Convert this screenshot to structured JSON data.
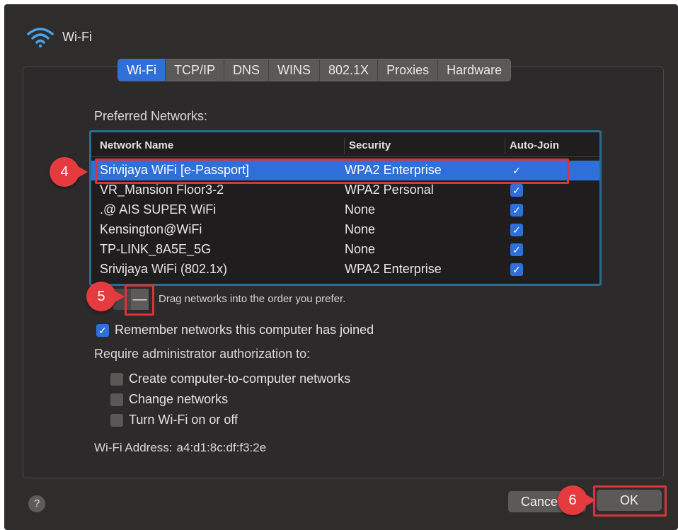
{
  "header": {
    "title": "Wi-Fi",
    "icon": "wifi-icon"
  },
  "tabs": [
    {
      "label": "Wi-Fi",
      "active": true
    },
    {
      "label": "TCP/IP",
      "active": false
    },
    {
      "label": "DNS",
      "active": false
    },
    {
      "label": "WINS",
      "active": false
    },
    {
      "label": "802.1X",
      "active": false
    },
    {
      "label": "Proxies",
      "active": false
    },
    {
      "label": "Hardware",
      "active": false
    }
  ],
  "preferred_label": "Preferred Networks:",
  "table": {
    "headers": {
      "name": "Network Name",
      "security": "Security",
      "auto_join": "Auto-Join"
    },
    "rows": [
      {
        "name": "Srivijaya WiFi [e-Passport]",
        "security": "WPA2 Enterprise",
        "auto_join": true,
        "selected": true
      },
      {
        "name": "VR_Mansion Floor3-2",
        "security": "WPA2 Personal",
        "auto_join": true
      },
      {
        "name": ".@ AIS SUPER WiFi",
        "security": "None",
        "auto_join": true
      },
      {
        "name": "Kensington@WiFi",
        "security": "None",
        "auto_join": true
      },
      {
        "name": "TP-LINK_8A5E_5G",
        "security": "None",
        "auto_join": true
      },
      {
        "name": "Srivijaya WiFi (802.1x)",
        "security": "WPA2 Enterprise",
        "auto_join": true
      }
    ]
  },
  "controls": {
    "add": "",
    "remove": "—",
    "drag_hint": "Drag networks into the order you prefer."
  },
  "remember": {
    "label": "Remember networks this computer has joined",
    "checked": true
  },
  "require_label": "Require administrator authorization to:",
  "admin_options": [
    {
      "label": "Create computer-to-computer networks",
      "checked": false
    },
    {
      "label": "Change networks",
      "checked": false
    },
    {
      "label": "Turn Wi-Fi on or off",
      "checked": false
    }
  ],
  "address": {
    "label": "Wi-Fi Address:",
    "value": "a4:d1:8c:df:f3:2e"
  },
  "footer": {
    "help": "?",
    "cancel": "Cance",
    "ok": "OK"
  },
  "annotations": {
    "step4": "4",
    "step5": "5",
    "step6": "6"
  },
  "colors": {
    "accent": "#2f6fd9",
    "annotation_red": "#e53b3f",
    "window_bg": "#2f2c2c"
  }
}
